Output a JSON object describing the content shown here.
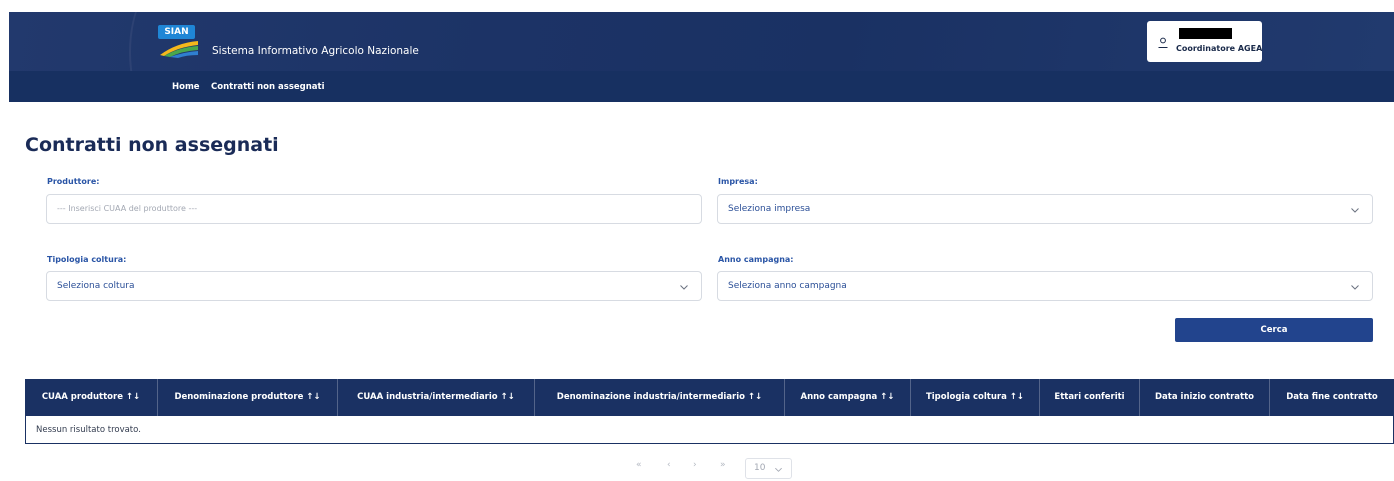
{
  "header": {
    "logo_text": "SIAN",
    "site_title": "Sistema Informativo Agricolo Nazionale",
    "user_role": "Coordinatore AGEA"
  },
  "nav": {
    "home": "Home",
    "current": "Contratti non assegnati"
  },
  "page": {
    "title": "Contratti non assegnati"
  },
  "form": {
    "produttore": {
      "label": "Produttore:",
      "placeholder": "--- Inserisci CUAA del produttore ---"
    },
    "impresa": {
      "label": "Impresa:",
      "value": "Seleziona impresa"
    },
    "tipologia": {
      "label": "Tipologia coltura:",
      "value": "Seleziona coltura"
    },
    "anno": {
      "label": "Anno campagna:",
      "value": "Seleziona anno campagna"
    },
    "search_label": "Cerca"
  },
  "table": {
    "columns": [
      "CUAA produttore ↑↓",
      "Denominazione produttore ↑↓",
      "CUAA industria/intermediario ↑↓",
      "Denominazione industria/intermediario ↑↓",
      "Anno campagna ↑↓",
      "Tipologia coltura ↑↓",
      "Ettari conferiti",
      "Data inizio contratto",
      "Data fine contratto"
    ],
    "empty_message": "Nessun risultato trovato."
  },
  "pagination": {
    "first": "«",
    "prev": "‹",
    "next": "›",
    "last": "»",
    "rows_per_page": "10"
  },
  "colors": {
    "header_bg": "#1c3366",
    "nav_bg": "#173061",
    "accent": "#22448d",
    "label": "#2a55a6"
  }
}
